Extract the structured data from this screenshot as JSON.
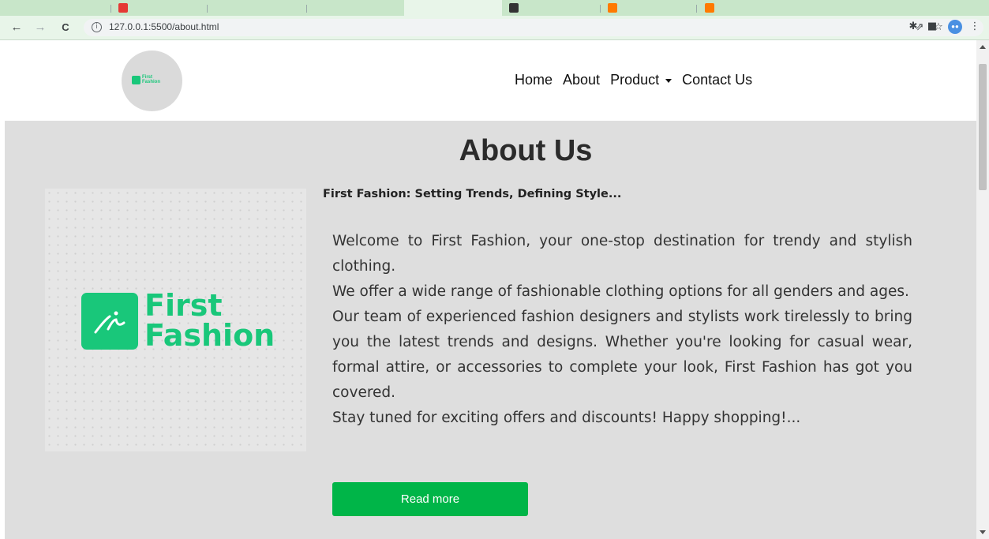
{
  "browser": {
    "url": "127.0.0.1:5500/about.html",
    "back_icon": "back-arrow-icon",
    "forward_icon": "forward-arrow-icon",
    "reload_icon": "reload-icon",
    "accent": "#e8f5e9"
  },
  "header": {
    "logo_text": "First Fashion",
    "logo_lines": [
      "First",
      "Fashion"
    ],
    "nav": {
      "home": "Home",
      "about": "About",
      "product": "Product",
      "contact": "Contact Us"
    }
  },
  "about": {
    "title": "About Us",
    "image_words": [
      "First",
      "Fashion"
    ],
    "tagline": "First Fashion: Setting Trends, Defining Style...",
    "paragraphs": [
      "Welcome to First Fashion, your one-stop destination for trendy and stylish clothing.",
      "We offer a wide range of fashionable clothing options for all genders and ages.",
      "Our team of experienced fashion designers and stylists work tirelessly to bring you the latest trends and designs. Whether you're looking for casual wear, formal attire, or accessories to complete your look, First Fashion has got you covered.",
      "Stay tuned for exciting offers and discounts! Happy shopping!..."
    ],
    "button": "Read more",
    "colors": {
      "brand_green": "#19c77a",
      "button_green": "#00b548",
      "section_bg": "#dedede"
    }
  }
}
